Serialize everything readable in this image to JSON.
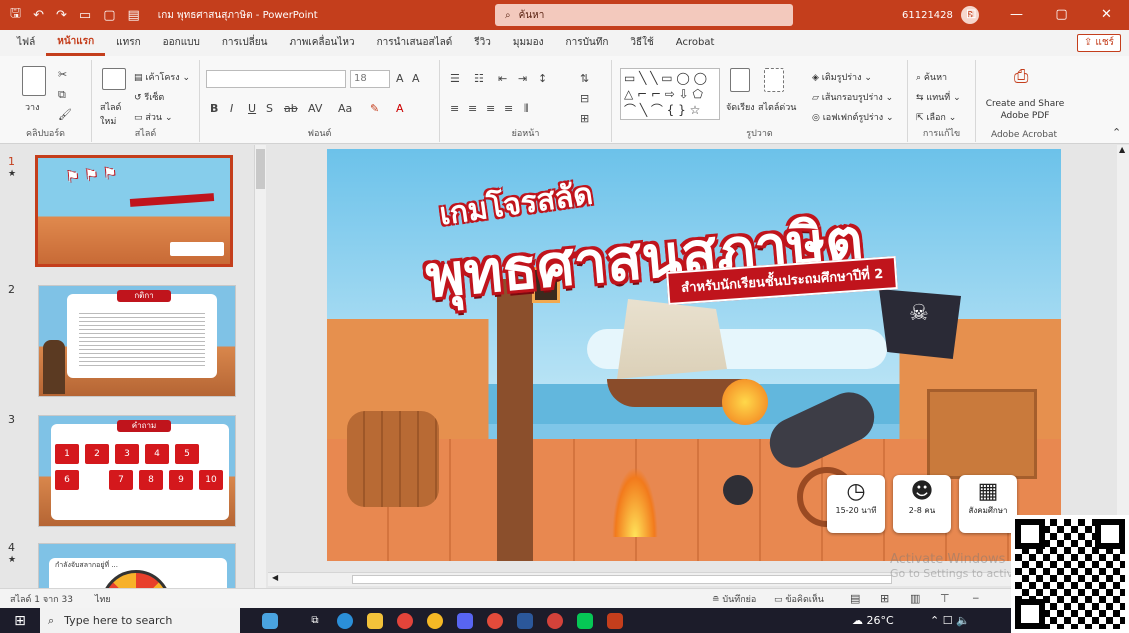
{
  "titlebar": {
    "doc_title": "เกม พุทธศาสนสุภาษิต - PowerPoint",
    "search_placeholder": "ค้นหา",
    "user": "61121428",
    "avatar_initial": "8"
  },
  "tabs": [
    "ไฟล์",
    "หน้าแรก",
    "แทรก",
    "ออกแบบ",
    "การเปลี่ยน",
    "ภาพเคลื่อนไหว",
    "การนำเสนอสไลด์",
    "รีวิว",
    "มุมมอง",
    "การบันทึก",
    "วิธีใช้",
    "Acrobat"
  ],
  "share_label": "แชร์",
  "ribbon": {
    "groups": {
      "clipboard": "คลิปบอร์ด",
      "slides": "สไลด์",
      "font": "ฟอนต์",
      "paragraph": "ย่อหน้า",
      "drawing": "รูปวาด",
      "editing": "การแก้ไข",
      "acrobat": "Adobe Acrobat"
    },
    "paste": "วาง",
    "new_slide": "สไลด์ใหม่",
    "layout": "เค้าโครง",
    "reset": "รีเซ็ต",
    "section": "ส่วน",
    "font_size": "18",
    "arrange": "จัดเรียง",
    "quick_styles": "สไตล์ด่วน",
    "shape_fill": "เติมรูปร่าง",
    "shape_outline": "เส้นกรอบรูปร่าง",
    "shape_effects": "เอฟเฟกต์รูปร่าง",
    "find": "ค้นหา",
    "replace": "แทนที่",
    "select": "เลือก",
    "create_pdf": "Create and Share Adobe PDF"
  },
  "slides": [
    {
      "num": "1"
    },
    {
      "num": "2",
      "heading": "กติกา"
    },
    {
      "num": "3",
      "heading": "คำถาม",
      "cells": [
        "1",
        "2",
        "3",
        "4",
        "5",
        "6",
        "7",
        "8",
        "9",
        "10"
      ]
    },
    {
      "num": "4",
      "caption": "กำลังจับสลากอยู่ที่ ..."
    }
  ],
  "slide": {
    "title_line1": "เกมโจรสลัด",
    "title_line2": "พุทธศาสนสุภาษิต",
    "subtitle": "สำหรับนักเรียนชั้นประถมศึกษาปีที่ 2",
    "info": [
      {
        "icon": "clock-icon",
        "label": "15-20 นาที"
      },
      {
        "icon": "group-icon",
        "label": "2-8 คน"
      },
      {
        "icon": "teacher-icon",
        "label": "สังคมศึกษา"
      }
    ],
    "watermark_line1": "Activate Windows",
    "watermark_line2": "Go to Settings to activate Windows."
  },
  "status": {
    "slide_of": "สไลด์ 1 จาก 33",
    "language": "ไทย",
    "notes": "บันทึกย่อ",
    "comments": "ข้อคิดเห็น"
  },
  "taskbar": {
    "search": "Type here to search",
    "temp": "26°C"
  }
}
